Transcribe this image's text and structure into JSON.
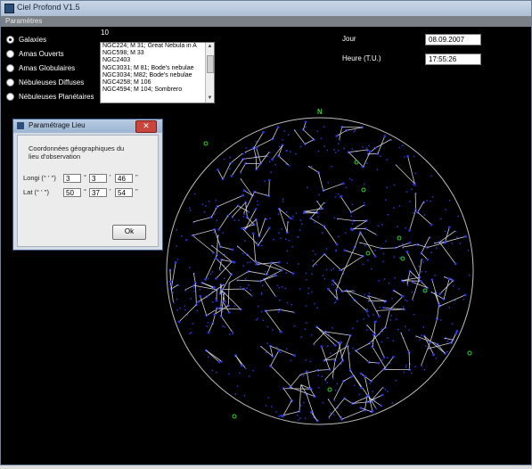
{
  "window": {
    "title": "Ciel Profond V1.5"
  },
  "menu": {
    "settings_label": "Paramètres"
  },
  "object_types": [
    {
      "label": "Galaxies",
      "checked": true
    },
    {
      "label": "Amas Ouverts",
      "checked": false
    },
    {
      "label": "Amas Globulaires",
      "checked": false
    },
    {
      "label": "Nébuleuses Diffuses",
      "checked": false
    },
    {
      "label": "Nébuleuses Planétaires",
      "checked": false
    }
  ],
  "object_count": "10",
  "object_list": [
    "NGC224; M 31; Great Nebula in A",
    "NGC598; M  33",
    "NGC2403",
    "NGC3031; M 81; Bode's nebulae",
    "NGC3034; M82; Bode's nebulae",
    "NGC4258; M 106",
    "NGC4594; M 104; Sombrero"
  ],
  "datetime": {
    "day_label": "Jour",
    "day_value": "08.09.2007",
    "hour_label": "Heure (T.U.)",
    "hour_value": "17:55:26"
  },
  "sky_map": {
    "north_label": "N",
    "colors": {
      "stars": "#2a35e0",
      "lines": "#cfcfcf",
      "objects": "#2bd62b",
      "horizon": "#bdbdbd"
    }
  },
  "dialog": {
    "title": "Paramétrage Lieu",
    "close_label": "✕",
    "heading_line1": "Coordonnées géographiques du",
    "heading_line2": "lieu d'observation",
    "longitude_label": "Longi (° ' '')",
    "latitude_label": "Lat (° ' '')",
    "longitude": {
      "deg": "3",
      "min": "3",
      "sec": "46"
    },
    "latitude": {
      "deg": "50",
      "min": "37",
      "sec": "54"
    },
    "unit_deg": "°",
    "unit_min": "'",
    "unit_sec": "''",
    "ok_label": "Ok"
  }
}
